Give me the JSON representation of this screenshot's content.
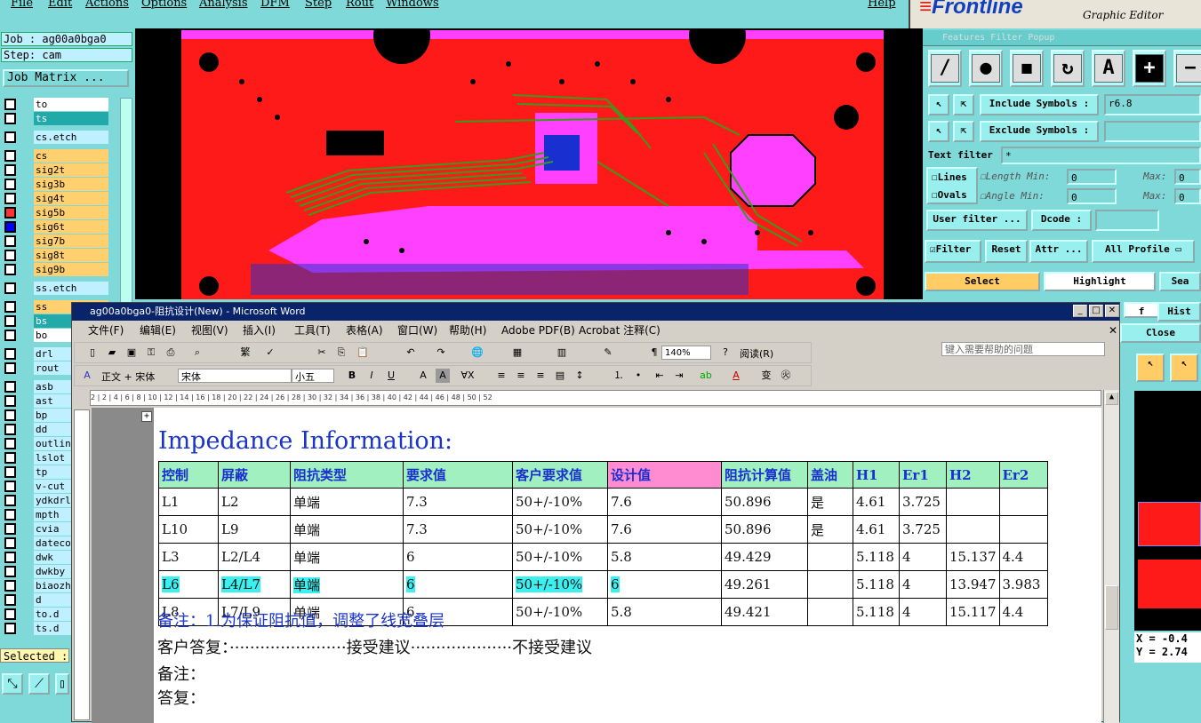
{
  "genesis": {
    "menu": [
      "File",
      "Edit",
      "Actions",
      "Options",
      "Analysis",
      "DFM",
      "Step",
      "Rout",
      "Windows",
      "Help"
    ],
    "brand": "Frontline",
    "brand_sub": "Graphic Editor",
    "job_label": "Job : ag00a0bga0",
    "step_label": "Step: cam",
    "job_matrix": "Job Matrix ...",
    "layers": [
      "to",
      "ts",
      "cs.etch",
      "cs",
      "sig2t",
      "sig3b",
      "sig4t",
      "sig5b",
      "sig6t",
      "sig7b",
      "sig8t",
      "sig9b",
      "ss.etch",
      "ss",
      "bs",
      "bo",
      "drl",
      "rout",
      "asb",
      "ast",
      "bp",
      "dd",
      "outlin",
      "lslot",
      "tp",
      "v-cut",
      "ydkdrl",
      "mpth",
      "cvia",
      "datecode",
      "dwk",
      "dwkby",
      "biaozhi",
      "d",
      "to.d",
      "ts.d"
    ],
    "selected_label": "Selected :",
    "coords": {
      "x": "X = -0.4",
      "y": "Y = 2.74"
    }
  },
  "filter": {
    "title": "Features Filter Popup",
    "include_symbols": "Include Symbols :",
    "include_value": "r6.8",
    "exclude_symbols": "Exclude Symbols :",
    "text_filter": "Text filter",
    "text_filter_value": "*",
    "lines": "Lines",
    "ovals": "Ovals",
    "length": "Length",
    "angle": "Angle",
    "min": "Min:",
    "max": "Max:",
    "zero": "0",
    "user_filter": "User filter ...",
    "dcode": "Dcode :",
    "filter": "Filter",
    "reset": "Reset",
    "attr": "Attr ...",
    "all_profile": "All Profile",
    "select": "Select",
    "highlight": "Highlight",
    "sea": "Sea",
    "hist": "Hist",
    "close": "Close",
    "f_char": "f"
  },
  "word": {
    "title": "ag00a0bga0-阻抗设计(New) - Microsoft Word",
    "menu": [
      "文件(F)",
      "编辑(E)",
      "视图(V)",
      "插入(I)",
      "工具(T)",
      "表格(A)",
      "窗口(W)",
      "帮助(H)",
      "Adobe PDF(B)",
      "Acrobat 注释(C)"
    ],
    "help_placeholder": "键入需要帮助的问题",
    "zoom": "140%",
    "read": "阅读(R)",
    "style": "正文 + 宋体",
    "font": "宋体",
    "size": "小五",
    "ruler": "2  |  2  |  4  |  6  |  8  |  10  |  12  |  14  |  16  |  18  |  20  |  22  |  24  |  26  |  28  |  30  |  32  |  34  |  36  |  38  |  40  |  42  |  44  |  46  |  48  |  50  |  52"
  },
  "doc": {
    "heading": "Impedance Information:",
    "columns": [
      "控制",
      "屏蔽",
      "阻抗类型",
      "要求值",
      "客户要求值",
      "设计值",
      "阻抗计算值",
      "盖油",
      "H1",
      "Er1",
      "H2",
      "Er2"
    ],
    "rows": [
      [
        "L1",
        "L2",
        "单端",
        "7.3",
        "50+/-10%",
        "7.6",
        "50.896",
        "是",
        "4.61",
        "3.725",
        "",
        ""
      ],
      [
        "L10",
        "L9",
        "单端",
        "7.3",
        "50+/-10%",
        "7.6",
        "50.896",
        "是",
        "4.61",
        "3.725",
        "",
        ""
      ],
      [
        "L3",
        "L2/L4",
        "单端",
        "6",
        "50+/-10%",
        "5.8",
        "49.429",
        "",
        "5.118",
        "4",
        "15.137",
        "4.4"
      ],
      [
        "L6",
        "L4/L7",
        "单端",
        "6",
        "50+/-10%",
        "6",
        "49.261",
        "",
        "5.118",
        "4",
        "13.947",
        "3.983"
      ],
      [
        "L8",
        "L7/L9",
        "单端",
        "6",
        "50+/-10%",
        "5.8",
        "49.421",
        "",
        "5.118",
        "4",
        "15.117",
        "4.4"
      ]
    ],
    "note1": "备注：1.为保证阻抗值，调整了线宽叠层",
    "reply": "客户答复：·······················接受建议····················不接受建议",
    "note2": "备注：",
    "answer": "答复："
  },
  "colors": {
    "board_red": "#ff1a1a",
    "board_magenta": "#ff40ff",
    "header_green": "#a0f0c0",
    "design_pink": "#ff8cd0",
    "highlight_cyan": "#3cf0f0"
  }
}
